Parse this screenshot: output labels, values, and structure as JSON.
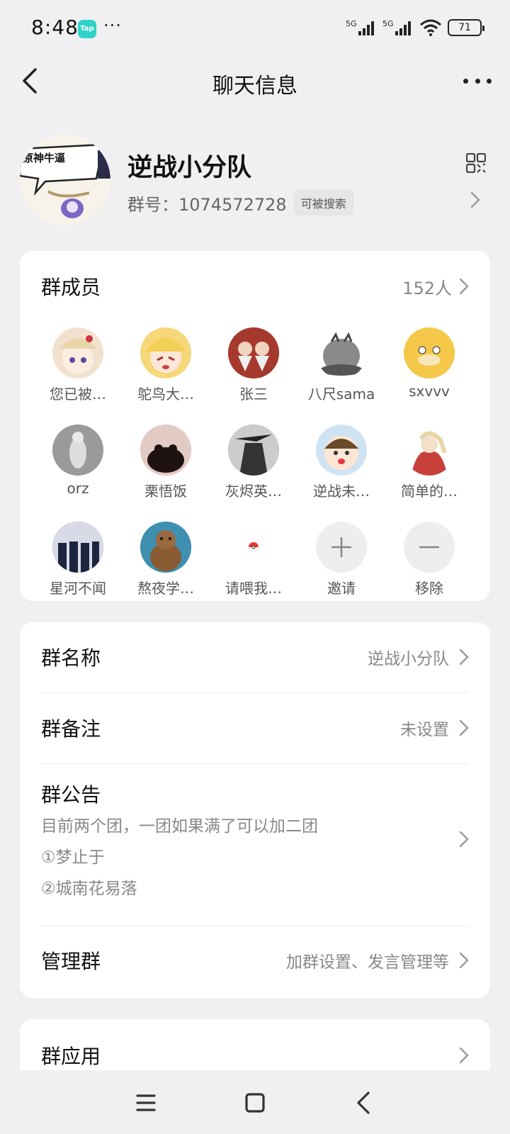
{
  "status_bar": {
    "time": "8:48",
    "app_badge": "Tap",
    "dots": "···",
    "battery": "71"
  },
  "header": {
    "title": "聊天信息"
  },
  "group": {
    "name": "逆战小分队",
    "id_label": "群号：1074572728",
    "searchable_badge": "可被搜索",
    "avatar_text": "原神牛逼"
  },
  "members": {
    "title": "群成员",
    "count": "152人",
    "list": [
      {
        "name": "您已被…",
        "color": "#f3e1cf"
      },
      {
        "name": "鸵鸟大…",
        "color": "#f6d77a"
      },
      {
        "name": "张三",
        "color": "#c84a3a"
      },
      {
        "name": "八尺sama",
        "color": "#9a9a9a"
      },
      {
        "name": "sxvvv",
        "color": "#f5c84a"
      },
      {
        "name": "orz",
        "color": "#b9b9b9"
      },
      {
        "name": "栗悟饭",
        "color": "#d9c0bb"
      },
      {
        "name": "灰烬英…",
        "color": "#5c5c5c"
      },
      {
        "name": "逆战未…",
        "color": "#cfe3f2"
      },
      {
        "name": "简单的…",
        "color": "#c8403a"
      },
      {
        "name": "星河不闻",
        "color": "#2f3b63"
      },
      {
        "name": "熬夜学…",
        "color": "#3f8fb0"
      },
      {
        "name": "请喂我…",
        "color": "#ffffff"
      }
    ],
    "invite_label": "邀请",
    "remove_label": "移除"
  },
  "settings": {
    "group_name_label": "群名称",
    "group_name_value": "逆战小分队",
    "remark_label": "群备注",
    "remark_value": "未设置",
    "announcement_label": "群公告",
    "announcement_lines": [
      "目前两个团，一团如果满了可以加二团",
      "①梦止于",
      "②城南花易落"
    ],
    "manage_label": "管理群",
    "manage_value": "加群设置、发言管理等"
  },
  "apps": {
    "label": "群应用"
  }
}
